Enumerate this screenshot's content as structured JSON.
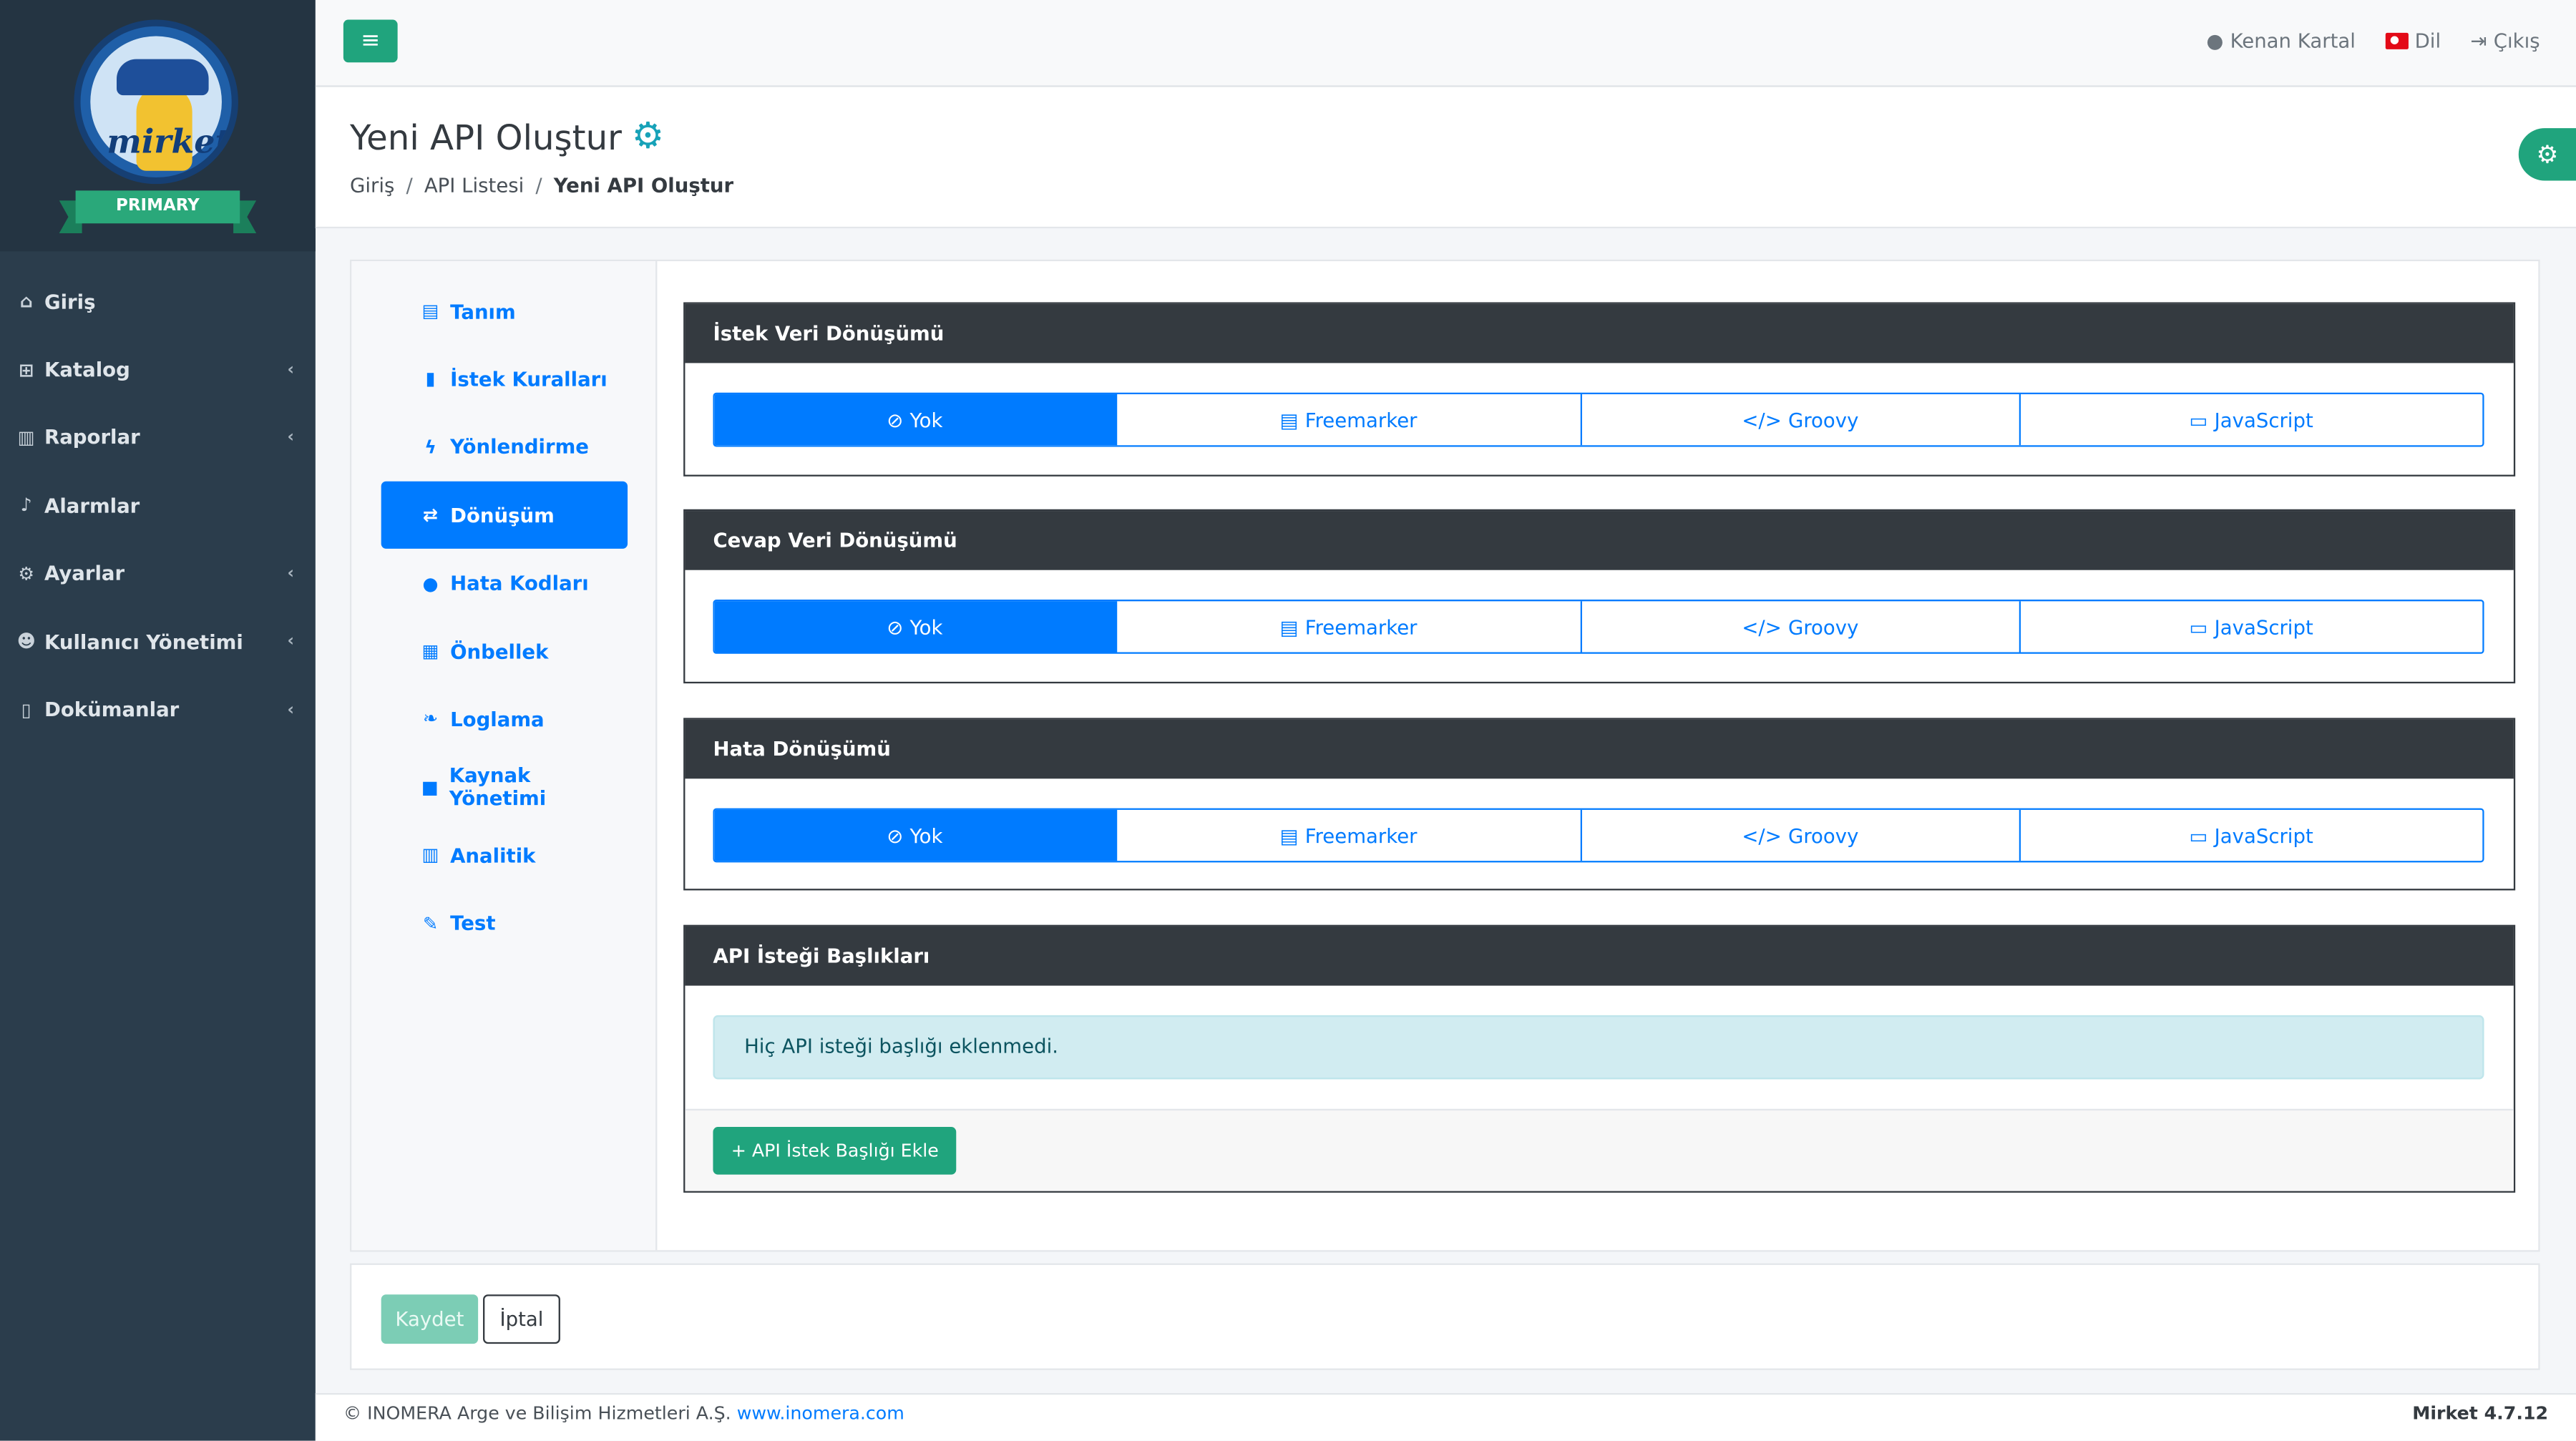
{
  "brand": {
    "logo_text": "mirket",
    "ribbon": "PRIMARY"
  },
  "sidebar": {
    "items": [
      {
        "label": "Giriş",
        "icon": "home-icon",
        "glyph": "⌂"
      },
      {
        "label": "Katalog",
        "icon": "sitemap-icon",
        "glyph": "⊞",
        "chevron": "‹"
      },
      {
        "label": "Raporlar",
        "icon": "chart-icon",
        "glyph": "▥",
        "chevron": "‹"
      },
      {
        "label": "Alarmlar",
        "icon": "bell-icon",
        "glyph": "♪"
      },
      {
        "label": "Ayarlar",
        "icon": "cogs-icon",
        "glyph": "⚙",
        "chevron": "‹"
      },
      {
        "label": "Kullanıcı Yönetimi",
        "icon": "users-icon",
        "glyph": "☻",
        "chevron": "‹"
      },
      {
        "label": "Dokümanlar",
        "icon": "file-icon",
        "glyph": "▯",
        "chevron": "‹"
      }
    ]
  },
  "topbar": {
    "toggle_glyph": "≡",
    "user": "Kenan Kartal",
    "language": "Dil",
    "logout": "Çıkış"
  },
  "header": {
    "title": "Yeni API Oluştur",
    "breadcrumb": [
      "Giriş",
      "API Listesi",
      "Yeni API Oluştur"
    ]
  },
  "tabs": [
    {
      "label": "Tanım",
      "icon": "id-card-icon",
      "glyph": "▤"
    },
    {
      "label": "İstek Kuralları",
      "icon": "file-alt-icon",
      "glyph": "▮"
    },
    {
      "label": "Yönlendirme",
      "icon": "bolt-icon",
      "glyph": "ϟ"
    },
    {
      "label": "Dönüşüm",
      "icon": "exchange-icon",
      "glyph": "⇄",
      "active": true
    },
    {
      "label": "Hata Kodları",
      "icon": "exclamation-circle-icon",
      "glyph": "●"
    },
    {
      "label": "Önbellek",
      "icon": "memory-icon",
      "glyph": "▦"
    },
    {
      "label": "Loglama",
      "icon": "leaf-icon",
      "glyph": "❧"
    },
    {
      "label": "Kaynak Yönetimi",
      "icon": "lock-icon",
      "glyph": "■"
    },
    {
      "label": "Analitik",
      "icon": "chart-line-icon",
      "glyph": "▥"
    },
    {
      "label": "Test",
      "icon": "pen-icon",
      "glyph": "✎"
    }
  ],
  "transform_options": [
    {
      "label": "Yok",
      "glyph": "⊘",
      "icon": "ban-icon"
    },
    {
      "label": "Freemarker",
      "glyph": "▤",
      "icon": "file-code-icon"
    },
    {
      "label": "Groovy",
      "glyph": "</>",
      "icon": "code-icon"
    },
    {
      "label": "JavaScript",
      "glyph": "▭",
      "icon": "laptop-code-icon"
    }
  ],
  "sections": {
    "request": {
      "title": "İstek Veri Dönüşümü",
      "selected": "Yok"
    },
    "response": {
      "title": "Cevap Veri Dönüşümü",
      "selected": "Yok"
    },
    "error": {
      "title": "Hata Dönüşümü",
      "selected": "Yok"
    },
    "headers": {
      "title": "API İsteği Başlıkları",
      "empty_message": "Hiç API isteği başlığı eklenmedi.",
      "add_button": "+ API İstek Başlığı Ekle"
    }
  },
  "actions": {
    "save": "Kaydet",
    "cancel": "İptal"
  },
  "footer": {
    "copyright": "© INOMERA Arge ve Bilişim Hizmetleri A.Ş.",
    "link": "www.inomera.com",
    "version": "Mirket 4.7.12"
  },
  "colors": {
    "primary": "#007bff",
    "success": "#20a47d",
    "sidebar": "#2b3d4c",
    "dark": "#343a40"
  }
}
